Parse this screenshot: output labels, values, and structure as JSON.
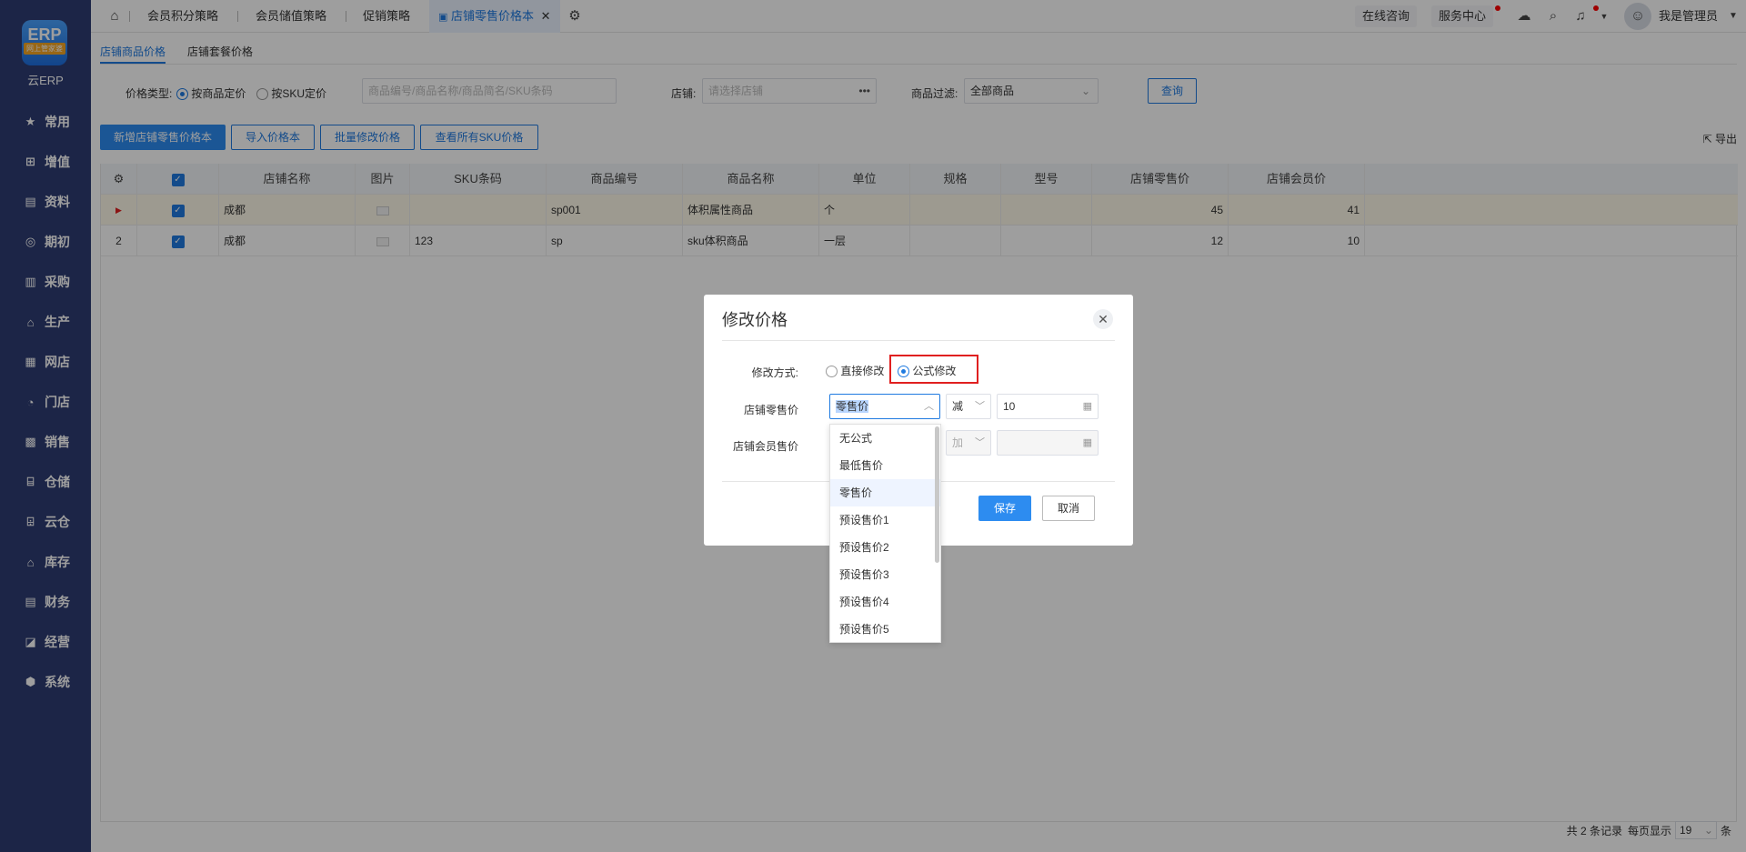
{
  "sidebar": {
    "logo_text": "ERP",
    "logo_tag": "网上管家婆",
    "brand": "云ERP",
    "items": [
      {
        "label": "常用",
        "icon": "star-icon"
      },
      {
        "label": "增值",
        "icon": "plus-square-icon"
      },
      {
        "label": "资料",
        "icon": "document-icon"
      },
      {
        "label": "期初",
        "icon": "target-icon"
      },
      {
        "label": "采购",
        "icon": "purchase-icon"
      },
      {
        "label": "生产",
        "icon": "production-icon"
      },
      {
        "label": "网店",
        "icon": "online-store-icon"
      },
      {
        "label": "门店",
        "icon": "pie-icon"
      },
      {
        "label": "销售",
        "icon": "bar-chart-icon"
      },
      {
        "label": "仓储",
        "icon": "warehouse-icon"
      },
      {
        "label": "云仓",
        "icon": "cloud-warehouse-icon"
      },
      {
        "label": "库存",
        "icon": "inventory-icon"
      },
      {
        "label": "财务",
        "icon": "finance-icon"
      },
      {
        "label": "经营",
        "icon": "business-icon"
      },
      {
        "label": "系统",
        "icon": "settings-hex-icon"
      }
    ]
  },
  "topbar": {
    "tabs": [
      "会员积分策略",
      "会员储值策略",
      "促销策略"
    ],
    "active_tab": "店铺零售价格本",
    "online_consult": "在线咨询",
    "service_center": "服务中心",
    "user_name": "我是管理员"
  },
  "main": {
    "sub_tabs": [
      "店铺商品价格",
      "店铺套餐价格"
    ],
    "filter": {
      "price_type_label": "价格类型:",
      "option_product": "按商品定价",
      "option_sku": "按SKU定价",
      "search_placeholder": "商品编号/商品名称/商品简名/SKU条码",
      "store_label": "店铺:",
      "store_placeholder": "请选择店铺",
      "filter_label": "商品过滤:",
      "filter_value": "全部商品",
      "query_button": "查询"
    },
    "toolbar": {
      "new_button": "新增店铺零售价格本",
      "import_button": "导入价格本",
      "batch_button": "批量修改价格",
      "view_sku_button": "查看所有SKU价格",
      "export_button": "导出"
    },
    "table": {
      "headers": [
        "店铺名称",
        "图片",
        "SKU条码",
        "商品编号",
        "商品名称",
        "单位",
        "规格",
        "型号",
        "店铺零售价",
        "店铺会员价"
      ],
      "rows": [
        {
          "index": "▶",
          "store": "成都",
          "sku": "",
          "code": "sp001",
          "name": "体积属性商品",
          "unit": "个",
          "spec": "",
          "model": "",
          "retail": "45",
          "member": "41"
        },
        {
          "index": "2",
          "store": "成都",
          "sku": "123",
          "code": "sp",
          "name": "sku体积商品",
          "unit": "一层",
          "spec": "",
          "model": "",
          "retail": "12",
          "member": "10"
        }
      ]
    },
    "footer": {
      "total": "共 2 条记录",
      "per_page_label": "每页显示",
      "per_page": "19",
      "unit": "条"
    }
  },
  "dialog": {
    "title": "修改价格",
    "mode_label": "修改方式:",
    "mode_direct": "直接修改",
    "mode_formula": "公式修改",
    "retail_label": "店铺零售价",
    "retail_base": "零售价",
    "retail_op": "减",
    "retail_value": "10",
    "member_label": "店铺会员售价",
    "member_op": "加",
    "save_button": "保存",
    "cancel_button": "取消",
    "dropdown_options": [
      "无公式",
      "最低售价",
      "零售价",
      "预设售价1",
      "预设售价2",
      "预设售价3",
      "预设售价4",
      "预设售价5"
    ],
    "highlight_color": "#e02020"
  }
}
